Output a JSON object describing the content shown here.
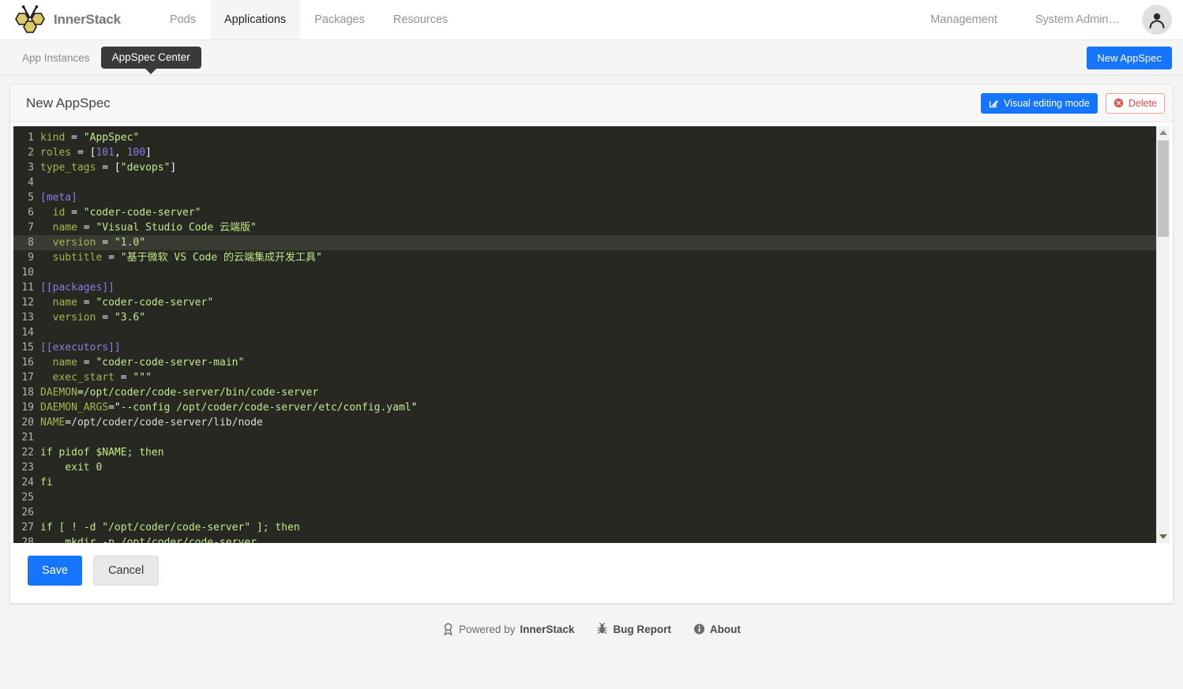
{
  "brand": {
    "name": "InnerStack",
    "logo_icon": "bee-honeycomb-logo"
  },
  "topnav": {
    "items": [
      {
        "label": "Pods",
        "active": false
      },
      {
        "label": "Applications",
        "active": true
      },
      {
        "label": "Packages",
        "active": false
      },
      {
        "label": "Resources",
        "active": false
      }
    ],
    "right_items": [
      {
        "label": "Management"
      },
      {
        "label": "System Admin…"
      }
    ],
    "avatar_icon": "user-avatar-icon"
  },
  "subnav": {
    "tabs": [
      {
        "label": "App Instances",
        "active": false
      },
      {
        "label": "AppSpec Center",
        "active": true
      }
    ],
    "new_button_label": "New AppSpec"
  },
  "card": {
    "title": "New AppSpec",
    "visual_edit_label": "Visual editing mode",
    "visual_edit_icon": "pencil-square-icon",
    "delete_label": "Delete",
    "delete_icon": "circle-x-icon"
  },
  "editor": {
    "language": "toml",
    "active_line": 8,
    "first_visible_line": 1,
    "last_visible_line": 28,
    "lines": [
      {
        "n": 1,
        "tokens": [
          {
            "t": "key",
            "v": "kind"
          },
          {
            "t": "op",
            "v": " = "
          },
          {
            "t": "str",
            "v": "\"AppSpec\""
          }
        ]
      },
      {
        "n": 2,
        "tokens": [
          {
            "t": "key",
            "v": "roles"
          },
          {
            "t": "op",
            "v": " = ["
          },
          {
            "t": "num",
            "v": "101"
          },
          {
            "t": "op",
            "v": ", "
          },
          {
            "t": "num",
            "v": "100"
          },
          {
            "t": "op",
            "v": "]"
          }
        ]
      },
      {
        "n": 3,
        "tokens": [
          {
            "t": "key",
            "v": "type_tags"
          },
          {
            "t": "op",
            "v": " = ["
          },
          {
            "t": "str",
            "v": "\"devops\""
          },
          {
            "t": "op",
            "v": "]"
          }
        ]
      },
      {
        "n": 4,
        "tokens": []
      },
      {
        "n": 5,
        "tokens": [
          {
            "t": "tbl",
            "v": "[meta]"
          }
        ]
      },
      {
        "n": 6,
        "tokens": [
          {
            "t": "op",
            "v": "  "
          },
          {
            "t": "key",
            "v": "id"
          },
          {
            "t": "op",
            "v": " = "
          },
          {
            "t": "str",
            "v": "\"coder-code-server\""
          }
        ]
      },
      {
        "n": 7,
        "tokens": [
          {
            "t": "op",
            "v": "  "
          },
          {
            "t": "key",
            "v": "name"
          },
          {
            "t": "op",
            "v": " = "
          },
          {
            "t": "str",
            "v": "\"Visual Studio Code 云端版\""
          }
        ]
      },
      {
        "n": 8,
        "tokens": [
          {
            "t": "op",
            "v": "  "
          },
          {
            "t": "key",
            "v": "version"
          },
          {
            "t": "op",
            "v": " = "
          },
          {
            "t": "str",
            "v": "\"1.0\""
          }
        ]
      },
      {
        "n": 9,
        "tokens": [
          {
            "t": "op",
            "v": "  "
          },
          {
            "t": "key",
            "v": "subtitle"
          },
          {
            "t": "op",
            "v": " = "
          },
          {
            "t": "str",
            "v": "\"基于微软 VS Code 的云端集成开发工具\""
          }
        ]
      },
      {
        "n": 10,
        "tokens": []
      },
      {
        "n": 11,
        "tokens": [
          {
            "t": "tbl",
            "v": "[[packages]]"
          }
        ]
      },
      {
        "n": 12,
        "tokens": [
          {
            "t": "op",
            "v": "  "
          },
          {
            "t": "key",
            "v": "name"
          },
          {
            "t": "op",
            "v": " = "
          },
          {
            "t": "str",
            "v": "\"coder-code-server\""
          }
        ]
      },
      {
        "n": 13,
        "tokens": [
          {
            "t": "op",
            "v": "  "
          },
          {
            "t": "key",
            "v": "version"
          },
          {
            "t": "op",
            "v": " = "
          },
          {
            "t": "str",
            "v": "\"3.6\""
          }
        ]
      },
      {
        "n": 14,
        "tokens": []
      },
      {
        "n": 15,
        "tokens": [
          {
            "t": "tbl",
            "v": "[[executors]]"
          }
        ]
      },
      {
        "n": 16,
        "tokens": [
          {
            "t": "op",
            "v": "  "
          },
          {
            "t": "key",
            "v": "name"
          },
          {
            "t": "op",
            "v": " = "
          },
          {
            "t": "str",
            "v": "\"coder-code-server-main\""
          }
        ]
      },
      {
        "n": 17,
        "tokens": [
          {
            "t": "op",
            "v": "  "
          },
          {
            "t": "key",
            "v": "exec_start"
          },
          {
            "t": "op",
            "v": " = "
          },
          {
            "t": "str",
            "v": "\"\"\""
          }
        ]
      },
      {
        "n": 18,
        "tokens": [
          {
            "t": "key",
            "v": "DAEMON"
          },
          {
            "t": "op",
            "v": "="
          },
          {
            "t": "str",
            "v": "/opt/coder/code-server/bin/code-server"
          }
        ]
      },
      {
        "n": 19,
        "tokens": [
          {
            "t": "key",
            "v": "DAEMON_ARGS"
          },
          {
            "t": "op",
            "v": "=\""
          },
          {
            "t": "str",
            "v": "--config /opt/coder/code-server/etc/config.yaml"
          },
          {
            "t": "op",
            "v": "\""
          }
        ]
      },
      {
        "n": 20,
        "tokens": [
          {
            "t": "key",
            "v": "NAME"
          },
          {
            "t": "op",
            "v": "="
          },
          {
            "t": "plain",
            "v": "/opt/coder/code-server/lib/node"
          }
        ]
      },
      {
        "n": 21,
        "tokens": []
      },
      {
        "n": 22,
        "tokens": [
          {
            "t": "str",
            "v": "if pidof $NAME; then"
          }
        ]
      },
      {
        "n": 23,
        "tokens": [
          {
            "t": "str",
            "v": "    exit 0"
          }
        ]
      },
      {
        "n": 24,
        "tokens": [
          {
            "t": "str",
            "v": "fi"
          }
        ]
      },
      {
        "n": 25,
        "tokens": []
      },
      {
        "n": 26,
        "tokens": []
      },
      {
        "n": 27,
        "tokens": [
          {
            "t": "str",
            "v": "if [ ! -d "
          },
          {
            "t": "str",
            "v": "\"/opt/coder/code-server\""
          },
          {
            "t": "str",
            "v": " ]; then"
          }
        ]
      },
      {
        "n": 28,
        "tokens": [
          {
            "t": "str",
            "v": "    mkdir -p /opt/coder/code-server"
          }
        ]
      }
    ]
  },
  "form": {
    "save_label": "Save",
    "cancel_label": "Cancel"
  },
  "footer": {
    "powered_prefix": "Powered by ",
    "powered_brand": "InnerStack",
    "powered_icon": "award-medal-icon",
    "bug_label": "Bug Report",
    "bug_icon": "bug-icon",
    "about_label": "About",
    "about_icon": "info-circle-icon"
  },
  "colors": {
    "accent": "#1675ff",
    "danger": "#ef4b4b",
    "editor_bg": "#272822",
    "editor_active_line": "#3a3c34",
    "logo_yellow": "#dcc864"
  }
}
